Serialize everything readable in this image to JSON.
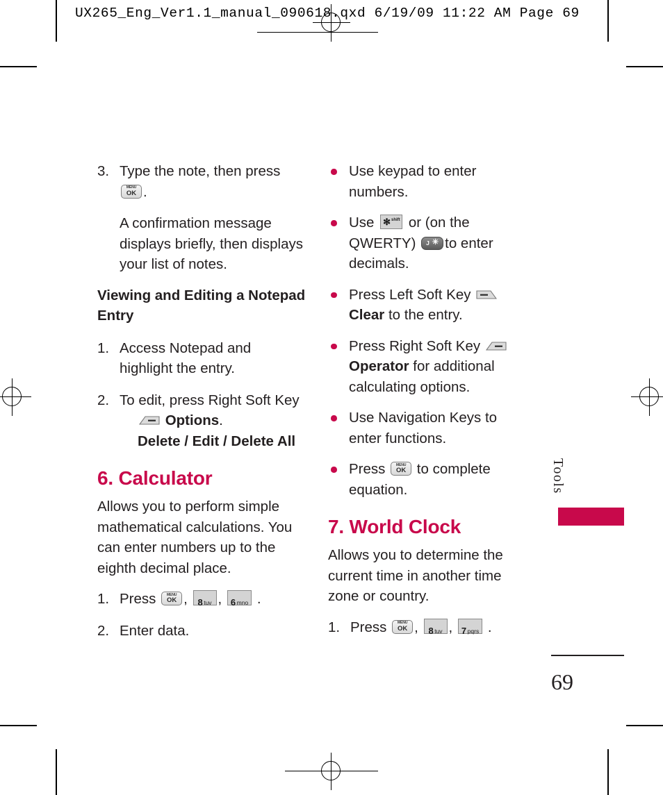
{
  "print_header": {
    "text": "UX265_Eng_Ver1.1_manual_090618.qxd   6/19/09   11:22 AM   Page 69"
  },
  "left_column": {
    "step3": {
      "num": "3.",
      "text_before": "Type the note, then press",
      "key": "menu-ok",
      "text_after": "."
    },
    "confirmation_note": "A confirmation message displays briefly, then displays your list of notes.",
    "subhead": "Viewing and Editing a Notepad Entry",
    "step1": {
      "num": "1.",
      "text": "Access Notepad and highlight the entry."
    },
    "step2": {
      "num": "2.",
      "text_before": "To edit, press Right Soft Key",
      "key": "right-soft-key",
      "label_bold": "Options",
      "text_after": ".",
      "options_line": "Delete / Edit / Delete All"
    },
    "section": {
      "title": "6. Calculator",
      "body": "Allows you to perform simple mathematical calculations. You can enter numbers up to the eighth decimal place.",
      "press_step": {
        "num": "1.",
        "label": "Press",
        "keys": [
          {
            "type": "menu-ok"
          },
          {
            "type": "num",
            "digit": "8",
            "letters": "tuv"
          },
          {
            "type": "num",
            "digit": "6",
            "letters": "mno"
          }
        ],
        "separator": ",",
        "terminator": "."
      },
      "enter_step": {
        "num": "2.",
        "text": "Enter data."
      }
    }
  },
  "right_column": {
    "bullets": [
      {
        "id": "use-keypad",
        "segments": [
          {
            "type": "text",
            "value": "Use keypad to enter numbers."
          }
        ]
      },
      {
        "id": "use-star-decimals",
        "segments": [
          {
            "type": "text",
            "value": "Use "
          },
          {
            "type": "key",
            "key": "star-shift"
          },
          {
            "type": "text",
            "value": " or (on the QWERTY) "
          },
          {
            "type": "key",
            "key": "qwerty-j-star"
          },
          {
            "type": "text",
            "value": "to enter decimals."
          }
        ]
      },
      {
        "id": "left-soft-key-clear",
        "segments": [
          {
            "type": "text",
            "value": "Press Left Soft Key "
          },
          {
            "type": "key",
            "key": "left-soft-key"
          },
          {
            "type": "bold",
            "value": " Clear"
          },
          {
            "type": "text",
            "value": " to the entry."
          }
        ]
      },
      {
        "id": "right-soft-key-operator",
        "segments": [
          {
            "type": "text",
            "value": "Press Right Soft Key "
          },
          {
            "type": "key",
            "key": "right-soft-key"
          },
          {
            "type": "bold",
            "value": " Operator"
          },
          {
            "type": "text",
            "value": " for additional calculating options."
          }
        ]
      },
      {
        "id": "navigation-keys",
        "segments": [
          {
            "type": "text",
            "value": "Use Navigation Keys to enter functions."
          }
        ]
      },
      {
        "id": "press-ok-complete",
        "segments": [
          {
            "type": "text",
            "value": "Press "
          },
          {
            "type": "key",
            "key": "menu-ok"
          },
          {
            "type": "text",
            "value": " to complete equation."
          }
        ]
      }
    ],
    "section": {
      "title": "7. World Clock",
      "body": "Allows you to determine the current time in another time zone or country.",
      "press_step": {
        "num": "1.",
        "label": "Press",
        "keys": [
          {
            "type": "menu-ok"
          },
          {
            "type": "num",
            "digit": "8",
            "letters": "tuv"
          },
          {
            "type": "num",
            "digit": "7",
            "letters": "pqrs"
          }
        ],
        "separator": ",",
        "terminator": "."
      }
    }
  },
  "side_tab": {
    "label": "Tools",
    "bar_color": "#c8094b"
  },
  "footer": {
    "page_number": "69"
  },
  "keys": {
    "menu_ok": {
      "top": "MENU",
      "bottom": "OK"
    },
    "star_shift": {
      "glyph": "✻",
      "sublabel": "shift"
    },
    "qwerty": {
      "letter": "J",
      "symbol": "✳"
    }
  },
  "colors": {
    "accent": "#c8094b",
    "text": "#231f20"
  }
}
